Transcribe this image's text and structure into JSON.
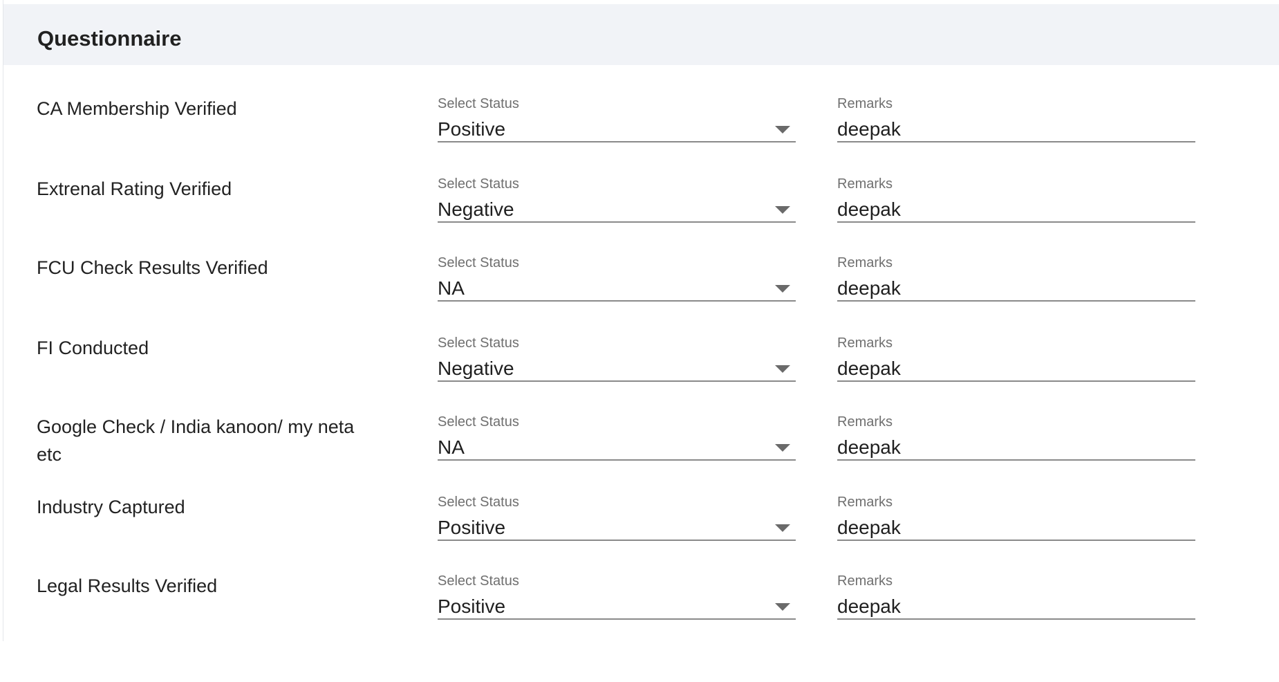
{
  "panel": {
    "title": "Questionnaire"
  },
  "field_labels": {
    "status": "Select Status",
    "remarks": "Remarks"
  },
  "questions": [
    {
      "label": "CA Membership Verified",
      "status": "Positive",
      "remarks": "deepak"
    },
    {
      "label": "Extrenal Rating Verified",
      "status": "Negative",
      "remarks": "deepak"
    },
    {
      "label": "FCU Check Results Verified",
      "status": "NA",
      "remarks": "deepak"
    },
    {
      "label": "FI Conducted",
      "status": "Negative",
      "remarks": "deepak"
    },
    {
      "label": "Google Check / India kanoon/ my neta etc",
      "status": "NA",
      "remarks": "deepak"
    },
    {
      "label": "Industry Captured",
      "status": "Positive",
      "remarks": "deepak"
    },
    {
      "label": "Legal Results Verified",
      "status": "Positive",
      "remarks": "deepak"
    }
  ],
  "icons": {
    "dropdown": "chevron-down-icon"
  }
}
